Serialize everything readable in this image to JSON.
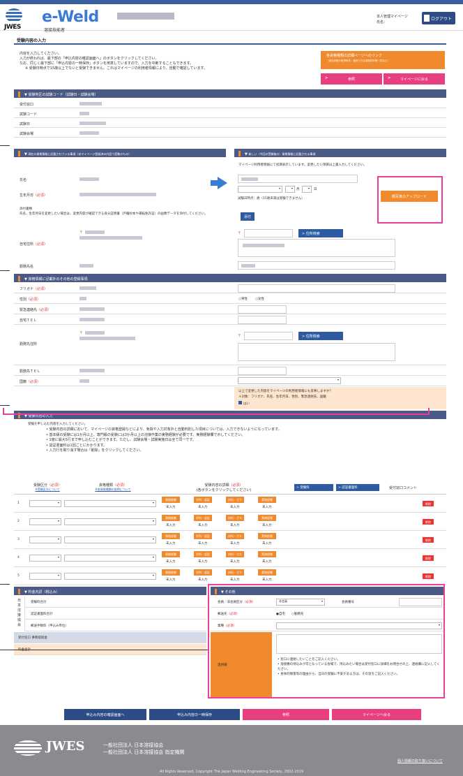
{
  "header": {
    "brand": "e-Weld",
    "brand_sub": "溶接技能者",
    "org": "JWES",
    "mypage_label": "本人管理マイページ",
    "name_label": "氏名：",
    "logout": "ログアウト"
  },
  "page_title": "受験内容の入力",
  "intro": [
    "内容を入力してください。",
    "入力が終われば、最下部の「申込内容の確認画面へ」のボタンをクリックしてください。",
    "なお、同じく最下部に「申込内容の一時保存」ボタンを用意していますので、入力を中断することもできます。",
    "※ 受験日時点で15歳以上でないと受験できません。これはマイページの利用者情報により、自動で確認しています。"
  ],
  "links": {
    "qualification": "各資格種類の詳細ページへのリンク",
    "qualification_sub": "（過去資格や取得条件、使用できる溶接材料等一覧など）",
    "reference": "参照",
    "mypage": "マイページに戻る"
  },
  "sections": {
    "exam": "受験地区の試験コード（試験日・試験会場）",
    "current": "現在の資格情報に記載されている事項（本マイページ登録済み内容で変動のもの）",
    "new": "新しい（今回の受験後の）資格情報に記載される事項",
    "other_info": "資格情報に記載外のその他の登録事項",
    "exam_input": "受験内容の入力",
    "fee": "料金内訳（税込み）",
    "others": "その他"
  },
  "exam_fields": [
    "受付窓口",
    "試験コード",
    "試験日",
    "試験会場"
  ],
  "new_note": "マイページ利用者情報にて初期表示しています。変更したい項目は上書入力してください。",
  "person": {
    "name": "氏名",
    "dob": "生年月日",
    "required": "（必須）",
    "month": "月",
    "day": "日",
    "age_note": "試験日時点：",
    "age_note2": "歳（15歳未満は受験できません）",
    "attach_title": "添付書類",
    "attach_text": "氏名、生年月日を変更したい場合は、変更内容が確認できる身分証明書（戸籍抄本や運転免許証）の画像データを添付してください。",
    "attach_btn": "添付",
    "address": "自宅住所",
    "postal": "〒",
    "addr_search": "住所検索",
    "employer": "勤務先名",
    "upload": "顔写真のアップロード"
  },
  "other_fields": {
    "kana": "フリガナ",
    "gender": "性別",
    "emergency": "緊急連絡先",
    "home_tel": "自宅ＴＥＬ",
    "work_addr": "勤務先住所",
    "work_tel": "勤務先ＴＥＬ",
    "nationality": "国籍",
    "male": "男性",
    "female": "女性",
    "reflect_q": "以上で変更した内容をマイページの利用者情報にも反映しますか？",
    "reflect_note": "＊対象：フリガナ、氏名、生年月日、性別、緊急連絡先、国籍",
    "reflect_yes": "はい"
  },
  "instructions": {
    "head": "受験を申し込む内容を入力してください。",
    "items": [
      "受験内容の詳細において、マイページの資格登録などにより、免除や入力対象外と自動判別した項目については、入力できないようになっています。",
      "基本級の受験には1か月以上、専門級の受験には3か月以上の溶接作業の実務経験が必要です。実務経験欄で示してください。",
      "1度に最大5行まで申し込むことができます。ただし、試験会場・試験実施日は全て同一です。",
      "認証書面料は1回ごとにかかります。",
      "入力行を取り消す場合は「削除」をクリックしてください。"
    ]
  },
  "table": {
    "col_type": "受験区分",
    "col_type_link": "※受験区分について",
    "col_qual": "資格種類",
    "col_qual_link": "※各資格種類の説明について",
    "col_detail": "受験内容の詳細",
    "col_detail_sub": "(各ボタンをクリックしてください)",
    "btn_fee": "受験料",
    "btn_cert": "認証書面料",
    "col_comment": "受付窓口コメント",
    "detail_btns": [
      "資格経験",
      "学科・認証",
      "材料・ガス",
      "実務経験"
    ],
    "not_entered": "未入力",
    "delete": "削除",
    "rows": [
      "1",
      "2",
      "3",
      "4",
      "5"
    ]
  },
  "fees": {
    "org_chars": "日本溶接協会",
    "exam_fee": "受験料合計",
    "cert_fee": "認証書面料合計",
    "handling_fee": "郵送手数料（申込み単位）",
    "window_fee": "受付窓口 事務取扱金",
    "total": "料金合計"
  },
  "others": {
    "member": "会員／非会員区分",
    "member_value": "非会員",
    "member_no": "会員番号",
    "mail_to": "郵送先",
    "home": "自宅",
    "office": "勤務先",
    "occupation": "業種",
    "message": "連絡欄",
    "message_notes": [
      "窓口に連絡したいことをご記入ください。",
      "溶接機の持込みが可となっている会場で、持込みたい場合は受付窓口に詳細をお問合せの上、連絡欄に記入してください。",
      "身体的障害等の理由から、当日の受験に不安がある方は、その旨をご記入ください。"
    ]
  },
  "footer_buttons": {
    "confirm": "申込み内容の確認画面へ",
    "save": "申込み内容の一時保存",
    "reference": "参照",
    "mypage": "マイページへ戻る"
  },
  "footer": {
    "org1": "一般社団法人 日本溶接協会",
    "org2": "一般社団法人 日本溶接協会 指定機関",
    "privacy": "個人情報の取り扱いについて",
    "copyright": "All Rights Reserved, Copyright The Japan Welding Engineering Society, 2002-2019"
  },
  "colors": {
    "header_blue": "#3a5f9e",
    "section": "#4a5a85",
    "accent_orange": "#f08a2c",
    "pink": "#e83f7f",
    "highlight": "#e83f9f"
  }
}
